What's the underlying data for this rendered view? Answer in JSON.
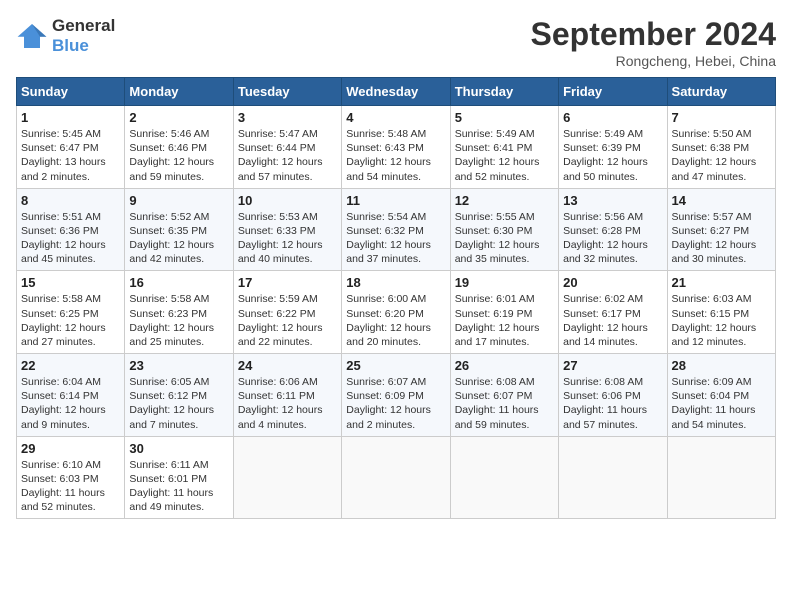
{
  "logo": {
    "line1": "General",
    "line2": "Blue"
  },
  "title": "September 2024",
  "location": "Rongcheng, Hebei, China",
  "days_of_week": [
    "Sunday",
    "Monday",
    "Tuesday",
    "Wednesday",
    "Thursday",
    "Friday",
    "Saturday"
  ],
  "weeks": [
    [
      {
        "day": "1",
        "info": "Sunrise: 5:45 AM\nSunset: 6:47 PM\nDaylight: 13 hours\nand 2 minutes."
      },
      {
        "day": "2",
        "info": "Sunrise: 5:46 AM\nSunset: 6:46 PM\nDaylight: 12 hours\nand 59 minutes."
      },
      {
        "day": "3",
        "info": "Sunrise: 5:47 AM\nSunset: 6:44 PM\nDaylight: 12 hours\nand 57 minutes."
      },
      {
        "day": "4",
        "info": "Sunrise: 5:48 AM\nSunset: 6:43 PM\nDaylight: 12 hours\nand 54 minutes."
      },
      {
        "day": "5",
        "info": "Sunrise: 5:49 AM\nSunset: 6:41 PM\nDaylight: 12 hours\nand 52 minutes."
      },
      {
        "day": "6",
        "info": "Sunrise: 5:49 AM\nSunset: 6:39 PM\nDaylight: 12 hours\nand 50 minutes."
      },
      {
        "day": "7",
        "info": "Sunrise: 5:50 AM\nSunset: 6:38 PM\nDaylight: 12 hours\nand 47 minutes."
      }
    ],
    [
      {
        "day": "8",
        "info": "Sunrise: 5:51 AM\nSunset: 6:36 PM\nDaylight: 12 hours\nand 45 minutes."
      },
      {
        "day": "9",
        "info": "Sunrise: 5:52 AM\nSunset: 6:35 PM\nDaylight: 12 hours\nand 42 minutes."
      },
      {
        "day": "10",
        "info": "Sunrise: 5:53 AM\nSunset: 6:33 PM\nDaylight: 12 hours\nand 40 minutes."
      },
      {
        "day": "11",
        "info": "Sunrise: 5:54 AM\nSunset: 6:32 PM\nDaylight: 12 hours\nand 37 minutes."
      },
      {
        "day": "12",
        "info": "Sunrise: 5:55 AM\nSunset: 6:30 PM\nDaylight: 12 hours\nand 35 minutes."
      },
      {
        "day": "13",
        "info": "Sunrise: 5:56 AM\nSunset: 6:28 PM\nDaylight: 12 hours\nand 32 minutes."
      },
      {
        "day": "14",
        "info": "Sunrise: 5:57 AM\nSunset: 6:27 PM\nDaylight: 12 hours\nand 30 minutes."
      }
    ],
    [
      {
        "day": "15",
        "info": "Sunrise: 5:58 AM\nSunset: 6:25 PM\nDaylight: 12 hours\nand 27 minutes."
      },
      {
        "day": "16",
        "info": "Sunrise: 5:58 AM\nSunset: 6:23 PM\nDaylight: 12 hours\nand 25 minutes."
      },
      {
        "day": "17",
        "info": "Sunrise: 5:59 AM\nSunset: 6:22 PM\nDaylight: 12 hours\nand 22 minutes."
      },
      {
        "day": "18",
        "info": "Sunrise: 6:00 AM\nSunset: 6:20 PM\nDaylight: 12 hours\nand 20 minutes."
      },
      {
        "day": "19",
        "info": "Sunrise: 6:01 AM\nSunset: 6:19 PM\nDaylight: 12 hours\nand 17 minutes."
      },
      {
        "day": "20",
        "info": "Sunrise: 6:02 AM\nSunset: 6:17 PM\nDaylight: 12 hours\nand 14 minutes."
      },
      {
        "day": "21",
        "info": "Sunrise: 6:03 AM\nSunset: 6:15 PM\nDaylight: 12 hours\nand 12 minutes."
      }
    ],
    [
      {
        "day": "22",
        "info": "Sunrise: 6:04 AM\nSunset: 6:14 PM\nDaylight: 12 hours\nand 9 minutes."
      },
      {
        "day": "23",
        "info": "Sunrise: 6:05 AM\nSunset: 6:12 PM\nDaylight: 12 hours\nand 7 minutes."
      },
      {
        "day": "24",
        "info": "Sunrise: 6:06 AM\nSunset: 6:11 PM\nDaylight: 12 hours\nand 4 minutes."
      },
      {
        "day": "25",
        "info": "Sunrise: 6:07 AM\nSunset: 6:09 PM\nDaylight: 12 hours\nand 2 minutes."
      },
      {
        "day": "26",
        "info": "Sunrise: 6:08 AM\nSunset: 6:07 PM\nDaylight: 11 hours\nand 59 minutes."
      },
      {
        "day": "27",
        "info": "Sunrise: 6:08 AM\nSunset: 6:06 PM\nDaylight: 11 hours\nand 57 minutes."
      },
      {
        "day": "28",
        "info": "Sunrise: 6:09 AM\nSunset: 6:04 PM\nDaylight: 11 hours\nand 54 minutes."
      }
    ],
    [
      {
        "day": "29",
        "info": "Sunrise: 6:10 AM\nSunset: 6:03 PM\nDaylight: 11 hours\nand 52 minutes."
      },
      {
        "day": "30",
        "info": "Sunrise: 6:11 AM\nSunset: 6:01 PM\nDaylight: 11 hours\nand 49 minutes."
      },
      {
        "day": "",
        "info": ""
      },
      {
        "day": "",
        "info": ""
      },
      {
        "day": "",
        "info": ""
      },
      {
        "day": "",
        "info": ""
      },
      {
        "day": "",
        "info": ""
      }
    ]
  ]
}
